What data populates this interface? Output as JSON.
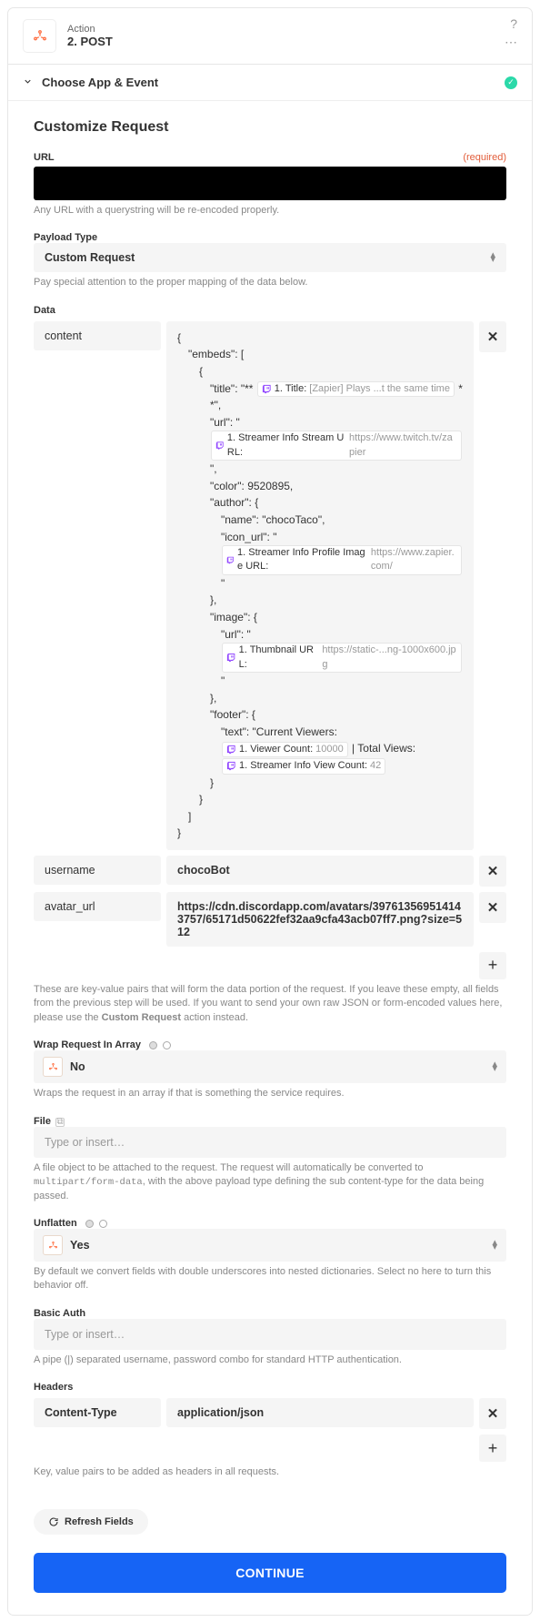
{
  "header": {
    "kind_label": "Action",
    "title": "2. POST"
  },
  "choose_section": {
    "title": "Choose App & Event"
  },
  "customize": {
    "heading": "Customize Request",
    "url": {
      "label": "URL",
      "required": "(required)",
      "helper": "Any URL with a querystring will be re-encoded properly."
    },
    "payload_type": {
      "label": "Payload Type",
      "value": "Custom Request",
      "helper": "Pay special attention to the proper mapping of the data below."
    },
    "data_section": {
      "label": "Data",
      "rows": {
        "content_key": "content",
        "username_key": "username",
        "username_value": "chocoBot",
        "avatar_key": "avatar_url",
        "avatar_value": "https://cdn.discordapp.com/avatars/397613569514143757/65171d50622fef32aa9cfa43acb07ff7.png?size=512"
      },
      "content_json": {
        "l1": "{",
        "l2": "\"embeds\": [",
        "l3": "{",
        "l4_a": "\"title\": \"** ",
        "l4_pill_label": "1. Title:",
        "l4_pill_sample": "[Zapier] Plays ...t the same time",
        "l4_b": " **\",",
        "l5_a": "\"url\": \" ",
        "l5_pill_label": "1. Streamer Info Stream URL:",
        "l5_pill_sample": "https://www.twitch.tv/zapier",
        "l5_b": " \",",
        "l6": "\"color\": 9520895,",
        "l7": "\"author\": {",
        "l8": "\"name\": \"chocoTaco\",",
        "l9_a": "\"icon_url\": \" ",
        "l9_pill_label": "1. Streamer Info Profile Image URL:",
        "l9_pill_sample": "https://www.zapier.com/",
        "l9_b": " \"",
        "l10": "},",
        "l11": "\"image\": {",
        "l12_a": "\"url\": \" ",
        "l12_pill_label": "1. Thumbnail URL:",
        "l12_pill_sample": "https://static-...ng-1000x600.jpg",
        "l12_b": " \"",
        "l13": "},",
        "l14": "\"footer\": {",
        "l15_a": "\"text\": \"Current Viewers: ",
        "l15_pill1_label": "1. Viewer Count:",
        "l15_pill1_sample": "10000",
        "l15_mid": "  | Total Views: ",
        "l15_pill2_label": "1. Streamer Info View Count:",
        "l15_pill2_sample": "42",
        "l15_b": "",
        "l16": "}",
        "l17": "}",
        "l18": "]",
        "l19": "}"
      },
      "helper_a": "These are key-value pairs that will form the data portion of the request. If you leave these empty, all fields from the previous step will be used. If you want to send your own raw JSON or form-encoded values here, please use the ",
      "helper_b": "Custom Request",
      "helper_c": " action instead."
    },
    "wrap": {
      "label": "Wrap Request In Array",
      "value": "No",
      "helper": "Wraps the request in an array if that is something the service requires."
    },
    "file": {
      "label": "File",
      "placeholder": "Type or insert…",
      "helper_a": "A file object to be attached to the request. The request will automatically be converted to ",
      "helper_code": "multipart/form-data",
      "helper_b": ", with the above payload type defining the sub content-type for the data being passed."
    },
    "unflatten": {
      "label": "Unflatten",
      "value": "Yes",
      "helper": "By default we convert fields with double underscores into nested dictionaries. Select no here to turn this behavior off."
    },
    "basic_auth": {
      "label": "Basic Auth",
      "placeholder": "Type or insert…",
      "helper": "A pipe (|) separated username, password combo for standard HTTP authentication."
    },
    "headers": {
      "label": "Headers",
      "key": "Content-Type",
      "value": "application/json",
      "helper": "Key, value pairs to be added as headers in all requests."
    },
    "refresh": "Refresh Fields",
    "continue": "CONTINUE"
  }
}
